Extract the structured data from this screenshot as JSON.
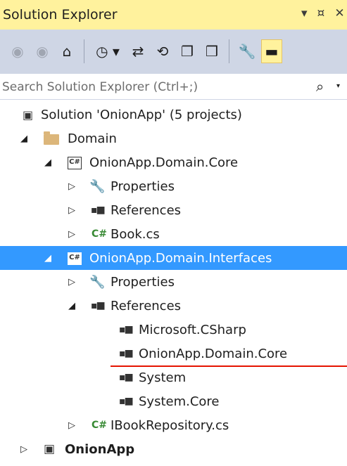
{
  "window": {
    "title": "Solution Explorer",
    "title_icons": [
      "dropdown-arrow-icon",
      "pin-icon",
      "close-icon"
    ],
    "title_glyphs": [
      "▾",
      "¤",
      "✕"
    ]
  },
  "toolbar": {
    "buttons": [
      {
        "name": "back-icon",
        "glyph": "◉"
      },
      {
        "name": "forward-icon",
        "glyph": "◉"
      },
      {
        "name": "home-icon",
        "glyph": "⌂"
      },
      {
        "name": "pending-changes-icon",
        "glyph": "◷ ▾"
      },
      {
        "name": "sync-icon",
        "glyph": "⇄"
      },
      {
        "name": "refresh-icon",
        "glyph": "⟲"
      },
      {
        "name": "collapse-all-icon",
        "glyph": "❐"
      },
      {
        "name": "show-all-files-icon",
        "glyph": "❒"
      },
      {
        "name": "properties-icon",
        "glyph": "🔧"
      },
      {
        "name": "preview-icon",
        "glyph": "▬"
      }
    ]
  },
  "search": {
    "placeholder": "Search Solution Explorer (Ctrl+;)",
    "icon": "search-icon",
    "glyph": "⌕",
    "arrow": "▾"
  },
  "tree": {
    "solution": {
      "label": "Solution 'OnionApp' (5 projects)"
    },
    "domain": {
      "label": "Domain"
    },
    "core": {
      "label": "OnionApp.Domain.Core"
    },
    "core_properties": {
      "label": "Properties"
    },
    "core_references": {
      "label": "References"
    },
    "core_book": {
      "label": "Book.cs"
    },
    "interfaces": {
      "label": "OnionApp.Domain.Interfaces",
      "selected": true
    },
    "if_properties": {
      "label": "Properties"
    },
    "if_references": {
      "label": "References"
    },
    "ref_mscsharp": {
      "label": "Microsoft.CSharp"
    },
    "ref_domaincore": {
      "label": "OnionApp.Domain.Core"
    },
    "ref_system": {
      "label": "System"
    },
    "ref_systemcore": {
      "label": "System.Core"
    },
    "ibookrepo": {
      "label": "IBookRepository.cs"
    },
    "onionapp": {
      "label": "OnionApp"
    }
  },
  "glyphs": {
    "expanded": "◢",
    "collapsed": "▷",
    "cs_file": "C#",
    "cs_project": "C#",
    "references": "▪■",
    "wrench": "🔧",
    "solution": "▣",
    "web": "▣"
  },
  "colors": {
    "title_bg": "#fff29d",
    "toolbar_bg": "#cfd6e5",
    "selection": "#3399ff",
    "annotation_underline": "#e51400"
  }
}
